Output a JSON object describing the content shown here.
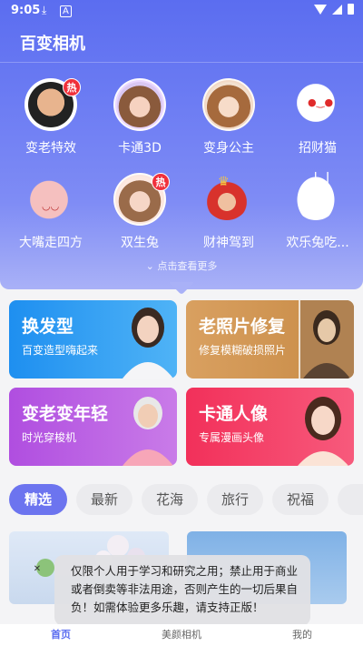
{
  "status": {
    "time": "9:05"
  },
  "app": {
    "title": "百变相机"
  },
  "effects": [
    {
      "label": "变老特效",
      "hot": "热"
    },
    {
      "label": "卡通3D"
    },
    {
      "label": "变身公主"
    },
    {
      "label": "招财猫"
    },
    {
      "label": "大嘴走四方"
    },
    {
      "label": "双生兔",
      "hot": "热"
    },
    {
      "label": "财神驾到"
    },
    {
      "label": "欢乐兔吃..."
    }
  ],
  "see_more": "点击查看更多",
  "cards": [
    {
      "title": "换发型",
      "subtitle": "百变造型嗨起来",
      "color_from": "#1e8ff0",
      "color_to": "#4fb3f6"
    },
    {
      "title": "老照片修复",
      "subtitle": "修复模糊破损照片",
      "color_from": "#d9a060",
      "color_to": "#c78a45"
    },
    {
      "title": "变老变年轻",
      "subtitle": "时光穿梭机",
      "color_from": "#b04ee0",
      "color_to": "#c97be8"
    },
    {
      "title": "卡通人像",
      "subtitle": "专属漫画头像",
      "color_from": "#f2305a",
      "color_to": "#f75a7c"
    }
  ],
  "chips": [
    "精选",
    "最新",
    "花海",
    "旅行",
    "祝福"
  ],
  "toast": {
    "text": "仅限个人用于学习和研究之用；禁止用于商业或者倒卖等非法用途，否则产生的一切后果自负！如需体验更多乐趣，请支持正版！"
  },
  "tabs": [
    {
      "label": "首页"
    },
    {
      "label": "美颜相机"
    },
    {
      "label": "我的"
    }
  ],
  "colors": {
    "hero_top": "#5b6df0",
    "accent": "#6c74ef",
    "hot_badge": "#f0303b"
  }
}
